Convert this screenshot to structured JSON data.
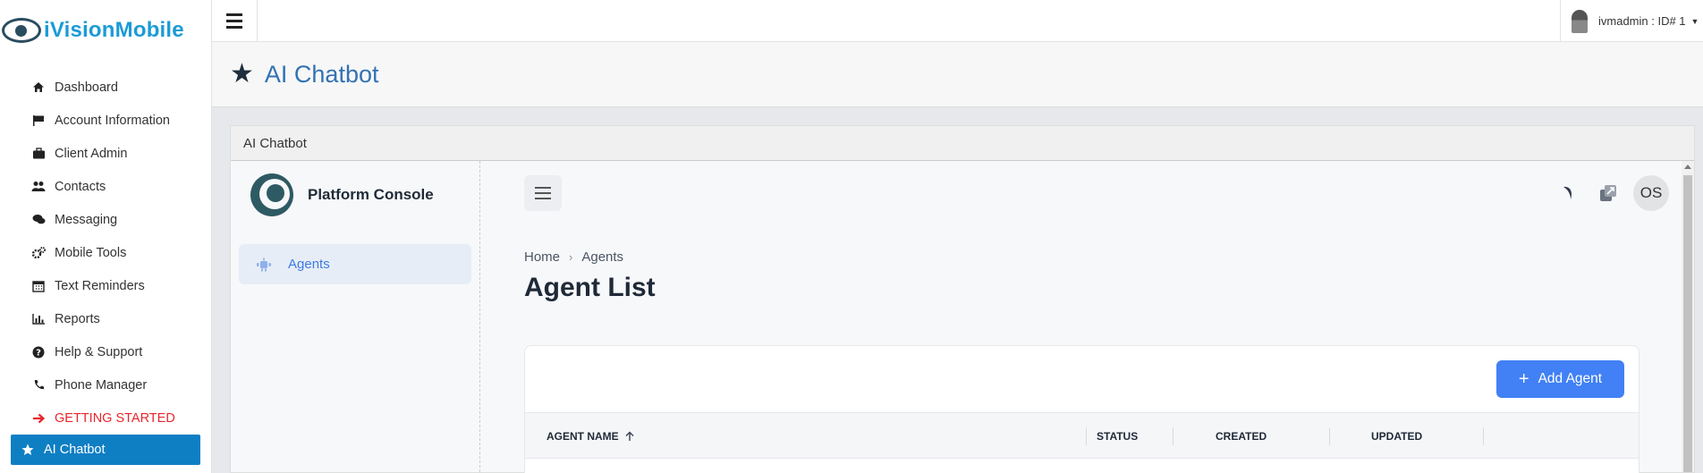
{
  "brand": {
    "name": "iVisionMobile"
  },
  "sidebar": {
    "items": [
      {
        "label": "Dashboard",
        "icon": "home-icon"
      },
      {
        "label": "Account Information",
        "icon": "flag-icon"
      },
      {
        "label": "Client Admin",
        "icon": "briefcase-icon"
      },
      {
        "label": "Contacts",
        "icon": "users-icon"
      },
      {
        "label": "Messaging",
        "icon": "chat-icon"
      },
      {
        "label": "Mobile Tools",
        "icon": "cogs-icon"
      },
      {
        "label": "Text Reminders",
        "icon": "calendar-icon"
      },
      {
        "label": "Reports",
        "icon": "bar-chart-icon"
      },
      {
        "label": "Help & Support",
        "icon": "question-icon"
      },
      {
        "label": "Phone Manager",
        "icon": "phone-icon"
      },
      {
        "label": "GETTING STARTED",
        "icon": "arrow-right-icon",
        "color": "#e8262b"
      },
      {
        "label": "AI Chatbot",
        "icon": "star-icon",
        "active": true,
        "color": "#0f7fc4"
      }
    ]
  },
  "header": {
    "user": "ivmadmin : ID# 1"
  },
  "page": {
    "title": "AI Chatbot"
  },
  "panel": {
    "title": "AI Chatbot"
  },
  "app": {
    "brand_name": "Platform Console",
    "nav": {
      "agents": "Agents"
    },
    "avatar_initials": "OS",
    "breadcrumb": {
      "home": "Home",
      "current": "Agents"
    },
    "title": "Agent List",
    "add_button": "Add Agent",
    "accent": "#4180f5",
    "table": {
      "columns": [
        "AGENT NAME",
        "STATUS",
        "CREATED",
        "UPDATED"
      ]
    }
  }
}
